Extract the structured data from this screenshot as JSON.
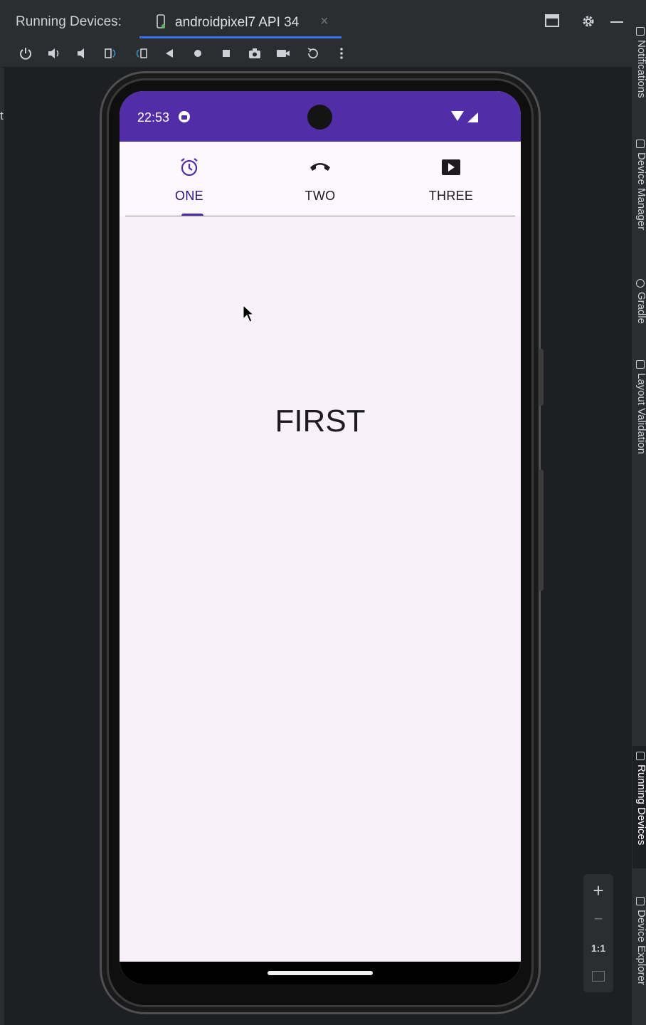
{
  "ide": {
    "panel_title": "Running Devices:",
    "device_tab": {
      "label": "androidpixel7 API 34",
      "close": "×"
    },
    "left_edge_text": "t",
    "toolbar_icons": [
      "power-icon",
      "volume-up-icon",
      "volume-down-icon",
      "rotate-left-icon",
      "rotate-right-icon",
      "back-icon",
      "home-icon",
      "overview-icon",
      "screenshot-icon",
      "screen-record-icon",
      "reset-icon",
      "more-icon"
    ],
    "right_tools": [
      "Notifications",
      "Device Manager",
      "Gradle",
      "Layout Validation",
      "Running Devices",
      "Device Explorer"
    ],
    "zoom": {
      "plus": "+",
      "minus": "−",
      "one_to_one": "1:1"
    }
  },
  "phone": {
    "status_bar": {
      "time": "22:53"
    },
    "tabs": [
      {
        "label": "ONE",
        "icon": "alarm-icon",
        "selected": true
      },
      {
        "label": "TWO",
        "icon": "phone-icon",
        "selected": false
      },
      {
        "label": "THREE",
        "icon": "play-icon",
        "selected": false
      }
    ],
    "content_text": "FIRST"
  },
  "colors": {
    "status_bar": "#512da8",
    "selected_tab": "#2a0f7a",
    "surface": "#fdf7fe",
    "ide_bg": "#2b2d30",
    "ide_accent": "#3574f0"
  }
}
